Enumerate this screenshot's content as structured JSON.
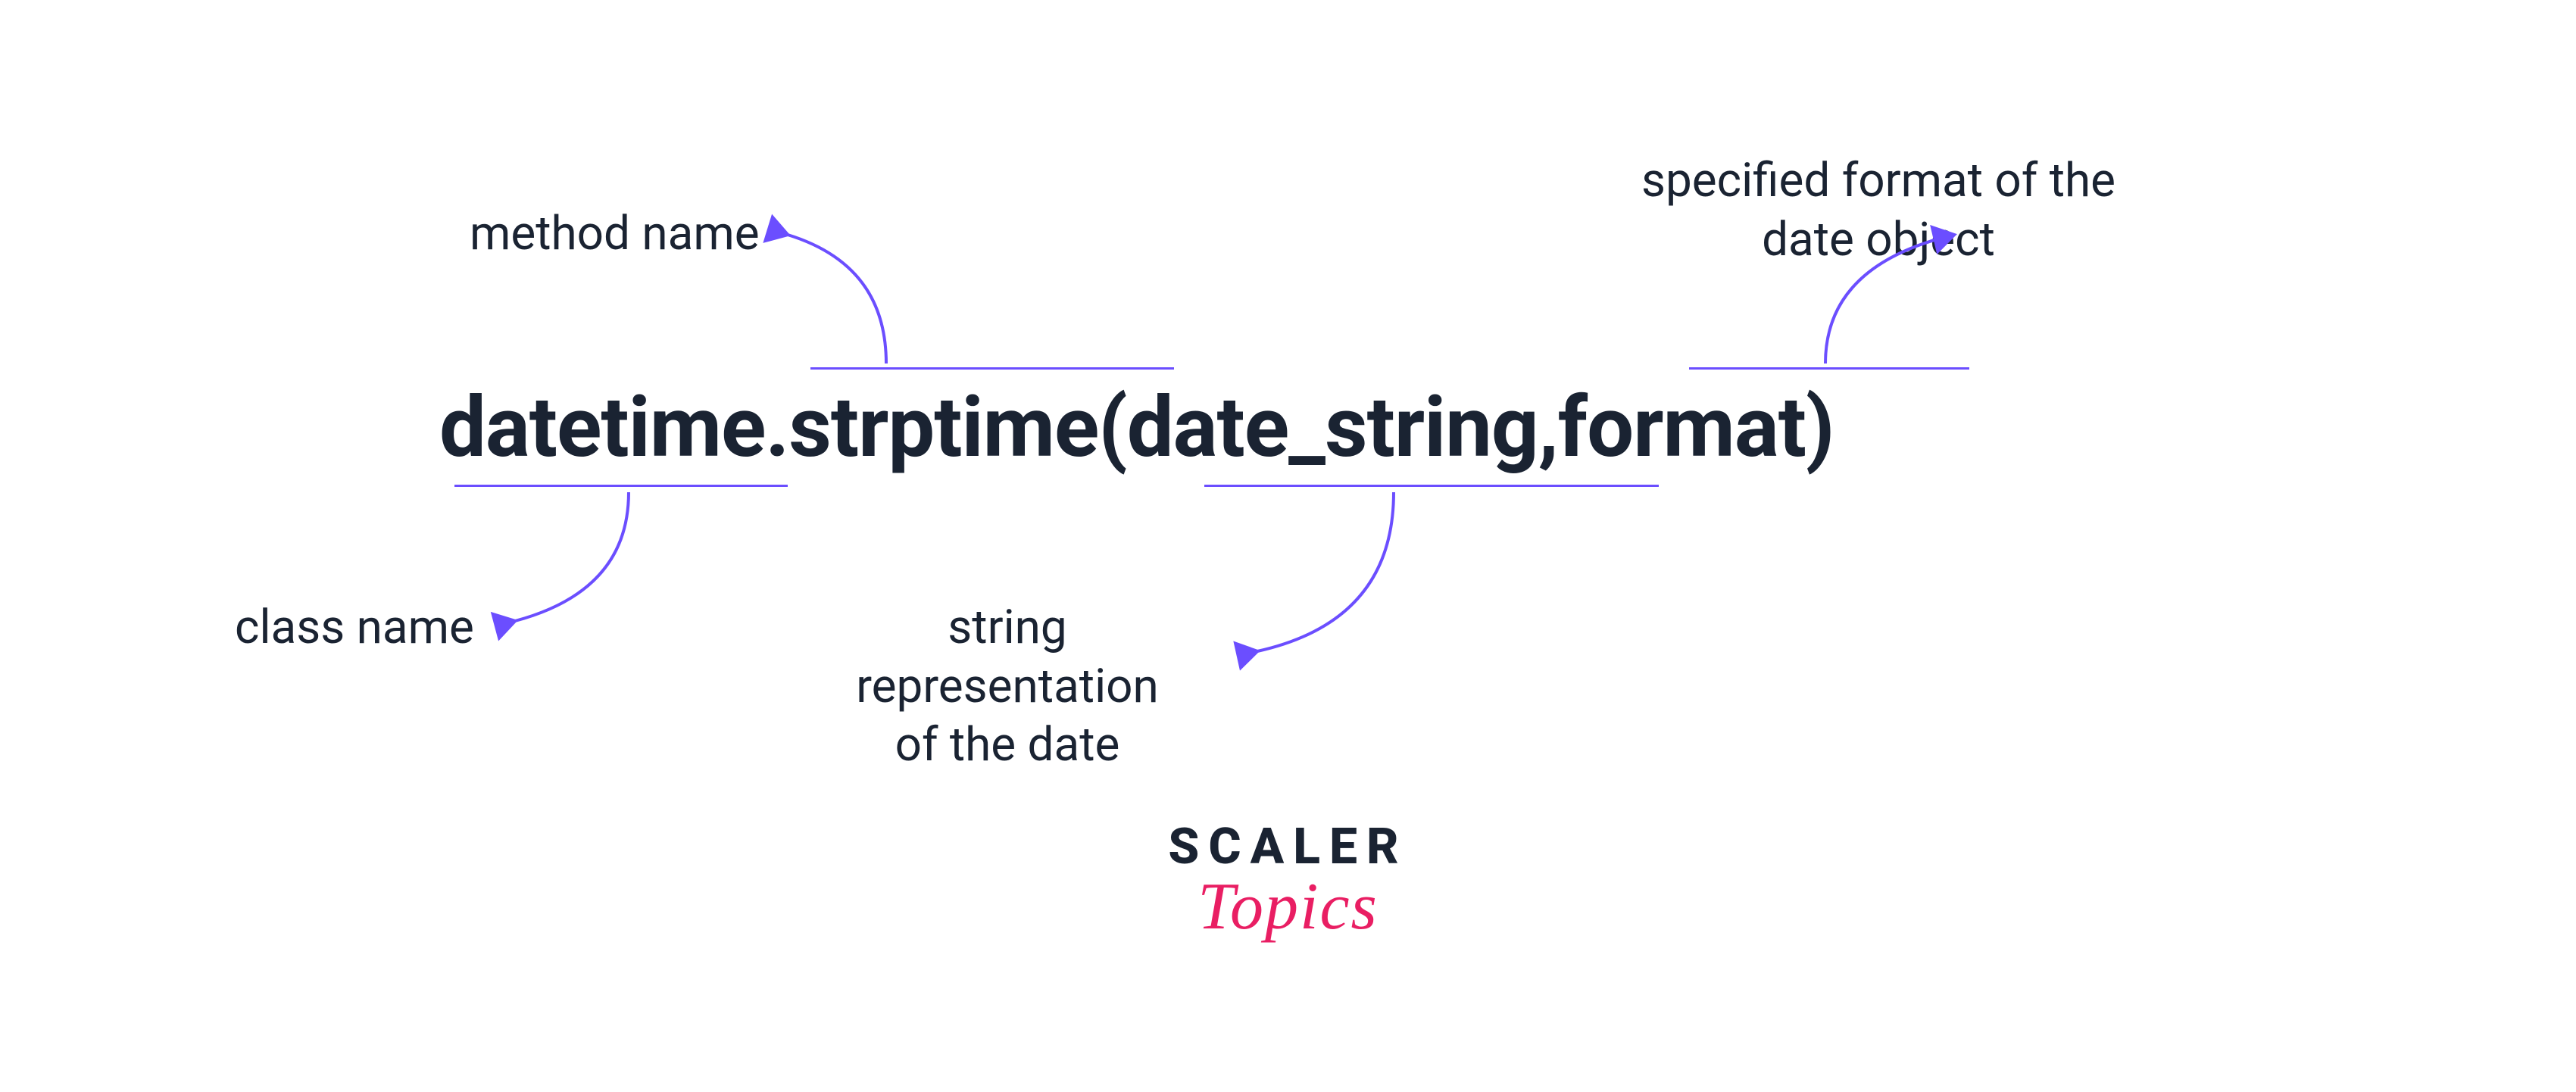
{
  "code": {
    "class_name": "datetime",
    "dot": ".",
    "method_name": "strptime",
    "open_paren": "(",
    "arg1": "date_string",
    "comma": ",",
    "space": " ",
    "arg2": "format",
    "close_paren": ")"
  },
  "annotations": {
    "method_name": "method name",
    "class_name": "class name",
    "string_repr_line1": "string representation",
    "string_repr_line2": "of the date",
    "format_line1": "specified format of the",
    "format_line2": "date object"
  },
  "logo": {
    "line1": "SCALER",
    "line2": "Topics"
  },
  "colors": {
    "text_dark": "#1a2332",
    "accent_purple": "#6b4eff",
    "accent_pink": "#e91e63"
  }
}
